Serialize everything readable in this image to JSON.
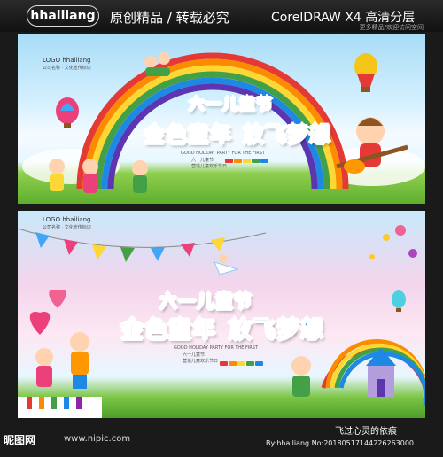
{
  "header": {
    "brand": "hhailiang",
    "tagline": "原创精品 / 转载必究",
    "software": "CorelDRAW X4  高清分层",
    "note": "更多精品/欢迎访问空间"
  },
  "panel_top": {
    "logo_text": "LOGO hhailiang",
    "logo_sub": "公司名称 · 文化宣传标识",
    "title_small": "六一儿童节",
    "title_big_a": "金色童年",
    "title_big_b": "放飞梦想",
    "mini_line1": "GOOD HOLIDAY PARTY FOR THE FIRST",
    "mini_line2": "六一儿童节",
    "mini_line3": "营造儿童欢乐节日"
  },
  "panel_bottom": {
    "logo_text": "LOGO hhailiang",
    "logo_sub": "公司名称 · 文化宣传标识",
    "title_small": "六一儿童节",
    "title_big_a": "金色童年",
    "title_big_b": "放飞梦想",
    "mini_line1": "GOOD HOLIDAY PARTY FOR THE FIRST",
    "mini_line2": "六一儿童节",
    "mini_line3": "营造儿童欢乐节日"
  },
  "footer": {
    "site": "昵图网",
    "url": "www.nipic.com",
    "weibo": "飞过心灵的依痕",
    "byline": "By:hhailiang No:20180517144226263000"
  },
  "colors": {
    "title_pink": "#e8248a",
    "title_orange": "#f29b1a",
    "title_blue": "#1a9ad6",
    "grass": "#5fae2d"
  }
}
